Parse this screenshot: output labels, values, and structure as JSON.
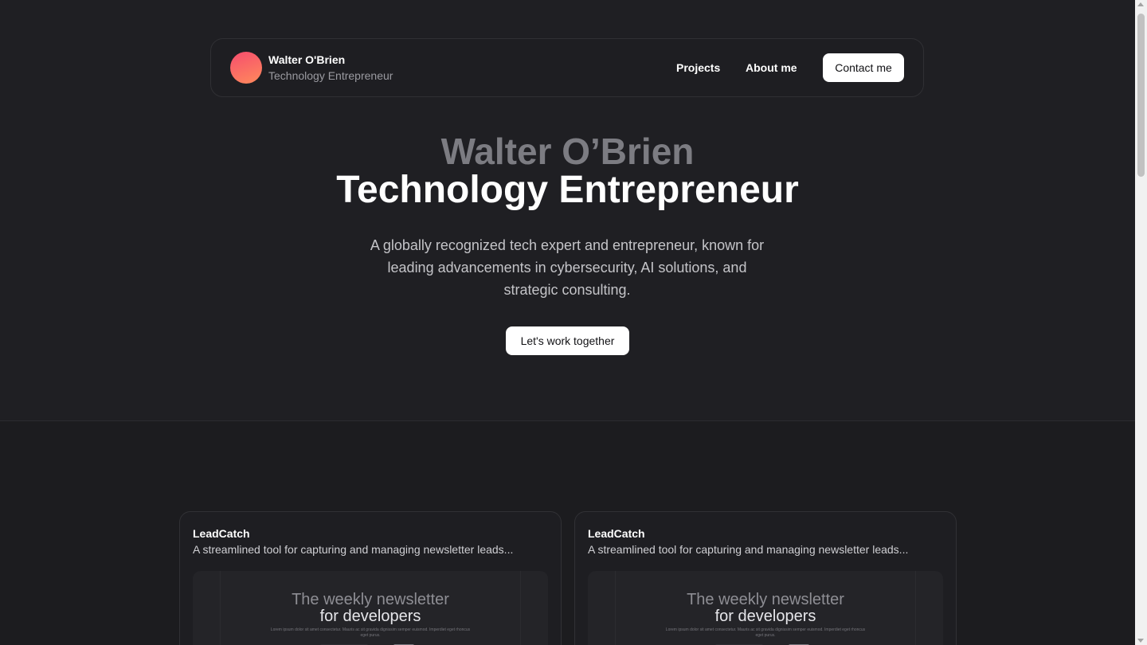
{
  "header": {
    "name": "Walter O'Brien",
    "role": "Technology Entrepreneur",
    "nav": {
      "projects": "Projects",
      "about": "About me",
      "contact": "Contact me"
    }
  },
  "hero": {
    "name": "Walter O’Brien",
    "title": "Technology Entrepreneur",
    "description": "A globally recognized tech expert and entrepreneur, known for leading advancements in cybersecurity, AI solutions, and strategic consulting.",
    "cta": "Let's work together"
  },
  "projects": [
    {
      "title": "LeadCatch",
      "description": "A streamlined tool for capturing and managing newsletter leads...",
      "preview": {
        "heading_1": "The weekly newsletter",
        "heading_2": "for developers",
        "body": "Lorem ipsum dolor sit amet consectetur. Mauris ac sit gravida dignissim semper euismod. Imperdiet eget rhoncus eget purus."
      }
    },
    {
      "title": "LeadCatch",
      "description": "A streamlined tool for capturing and managing newsletter leads...",
      "preview": {
        "heading_1": "The weekly newsletter",
        "heading_2": "for developers",
        "body": "Lorem ipsum dolor sit amet consectetur. Mauris ac sit gravida dignissim semper euismod. Imperdiet eget rhoncus eget purus."
      }
    }
  ],
  "colors": {
    "background": "#1c1c1f",
    "avatar_gradient_start": "#f64d6e",
    "avatar_gradient_end": "#ff8a5c",
    "button": "#ffffff"
  }
}
